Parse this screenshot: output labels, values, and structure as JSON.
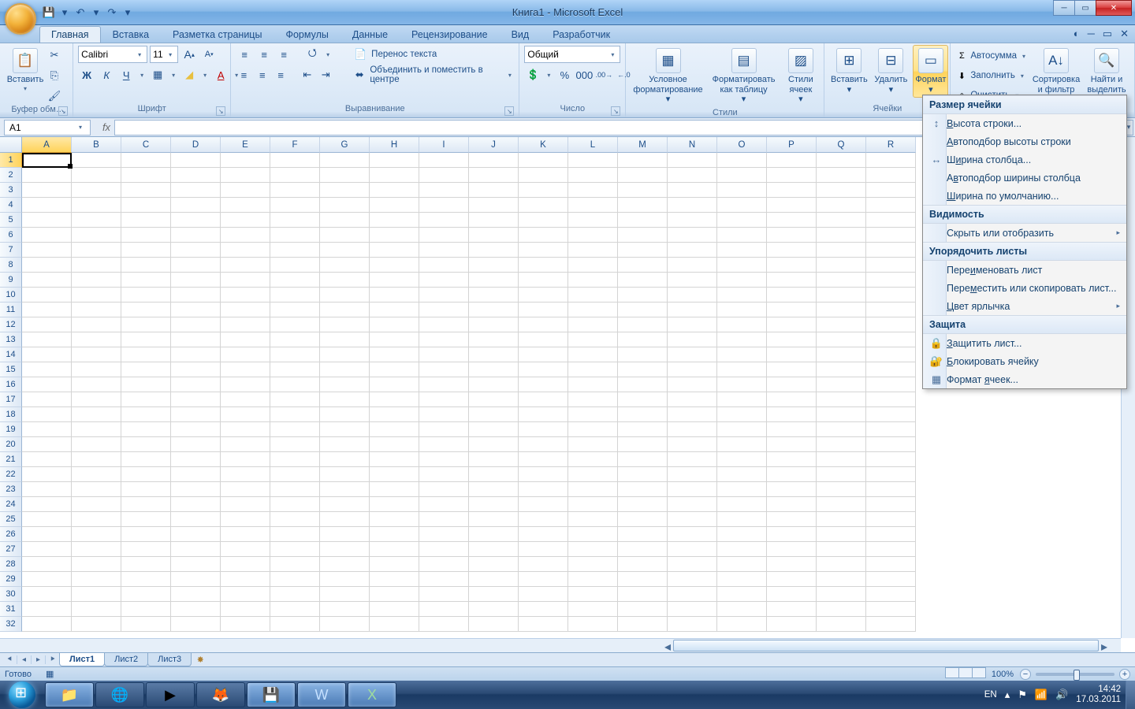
{
  "title": "Книга1 - Microsoft Excel",
  "qat": {
    "save": "💾",
    "undo": "↶",
    "redo": "↷"
  },
  "tabs": [
    "Главная",
    "Вставка",
    "Разметка страницы",
    "Формулы",
    "Данные",
    "Рецензирование",
    "Вид",
    "Разработчик"
  ],
  "ribbon": {
    "clipboard": {
      "paste": "Вставить",
      "label": "Буфер обм…"
    },
    "font": {
      "name": "Calibri",
      "size": "11",
      "bold": "Ж",
      "italic": "К",
      "under": "Ч",
      "grow": "A",
      "shrink": "A",
      "label": "Шрифт"
    },
    "align": {
      "wrap": "Перенос текста",
      "merge": "Объединить и поместить в центре",
      "label": "Выравнивание"
    },
    "number": {
      "format": "Общий",
      "label": "Число"
    },
    "styles": {
      "cond": "Условное форматирование",
      "table": "Форматировать как таблицу",
      "cell": "Стили ячеек",
      "label": "Стили"
    },
    "cells": {
      "insert": "Вставить",
      "delete": "Удалить",
      "format": "Формат",
      "label": "Ячейки"
    },
    "editing": {
      "sum": "Автосумма",
      "fill": "Заполнить",
      "clear": "Очистить",
      "sort": "Сортировка и фильтр",
      "find": "Найти и выделить"
    }
  },
  "namebox": "A1",
  "columns": [
    "A",
    "B",
    "C",
    "D",
    "E",
    "F",
    "G",
    "H",
    "I",
    "J",
    "K",
    "L",
    "M",
    "N",
    "O",
    "P",
    "Q",
    "R"
  ],
  "rowcount": 32,
  "menu": {
    "h1": "Размер ячейки",
    "i1": "Высота строки...",
    "i2": "Автоподбор высоты строки",
    "i3": "Ширина столбца...",
    "i4": "Автоподбор ширины столбца",
    "i5": "Ширина по умолчанию...",
    "h2": "Видимость",
    "i6": "Скрыть или отобразить",
    "h3": "Упорядочить листы",
    "i7": "Переименовать лист",
    "i8": "Переместить или скопировать лист...",
    "i9": "Цвет ярлычка",
    "h4": "Защита",
    "i10": "Защитить лист...",
    "i11": "Блокировать ячейку",
    "i12": "Формат ячеек..."
  },
  "sheets": [
    "Лист1",
    "Лист2",
    "Лист3"
  ],
  "status": {
    "ready": "Готово",
    "zoom": "100%"
  },
  "tray": {
    "lang": "EN",
    "time": "14:42",
    "date": "17.03.2011"
  }
}
